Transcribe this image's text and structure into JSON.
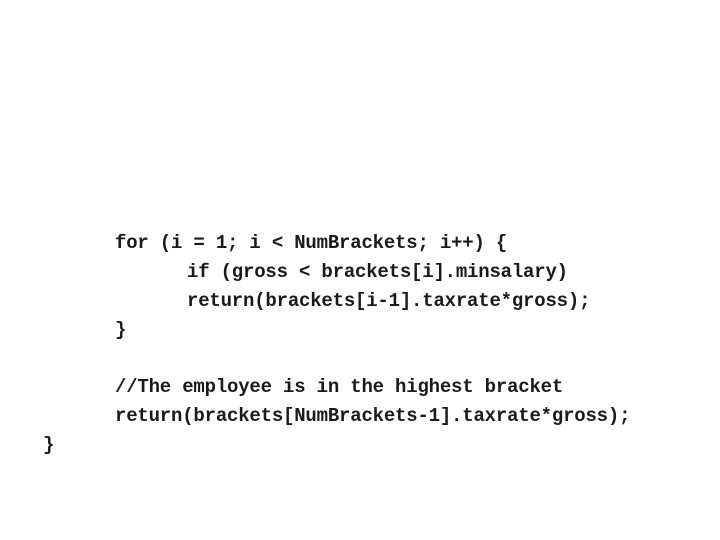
{
  "code": {
    "lines": [
      "for (i = 1; i < NumBrackets; i++) {",
      "if (gross < brackets[i].minsalary)",
      "return(brackets[i-1].taxrate*gross);",
      "}",
      "//The employee is in the highest bracket",
      "return(brackets[NumBrackets-1].taxrate*gross);",
      "}"
    ]
  }
}
